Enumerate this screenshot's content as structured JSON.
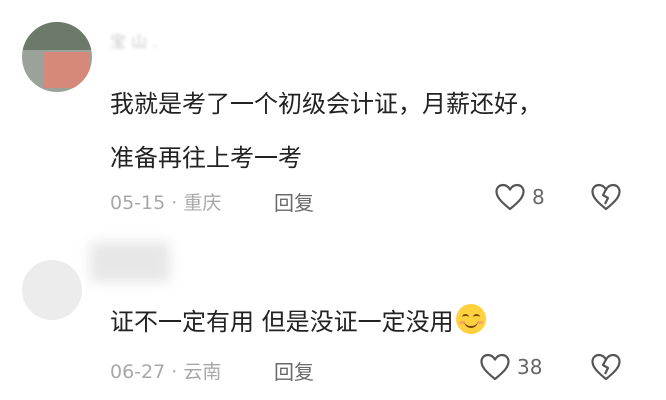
{
  "comments": [
    {
      "username": "宝 山 .",
      "lines": [
        "我就是考了一个初级会计证，月薪还好，",
        "准备再往上考一考"
      ],
      "date": "05-15",
      "location": "重庆",
      "reply_label": "回复",
      "likes": "8"
    },
    {
      "lines": [
        "证不一定有用 但是没证一定没用"
      ],
      "emoji": "smiling-face-emoji",
      "date": "06-27",
      "location": "云南",
      "reply_label": "回复",
      "likes": "38"
    }
  ],
  "separator": "·",
  "icons": {
    "like": "heart-outline-icon",
    "dislike": "broken-heart-icon"
  },
  "colors": {
    "text": "#222222",
    "meta": "#a8a8a8",
    "reply": "#6a6a6a",
    "icon": "#555555"
  }
}
